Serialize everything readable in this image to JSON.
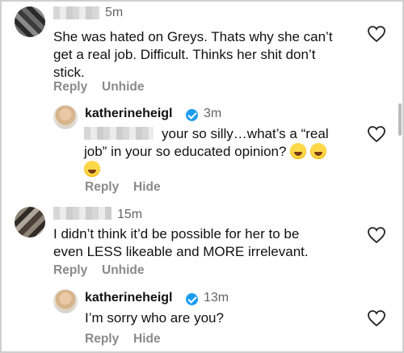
{
  "comments": [
    {
      "time": "5m",
      "text_lines": [
        "She was hated on Greys. Thats why she can’t",
        "get a real job. Difficult. Thinks her shit don’t",
        "stick."
      ],
      "reply_label": "Reply",
      "secondary_label": "Unhide"
    },
    {
      "username": "katherineheigl",
      "time": "3m",
      "text_lines": [
        "your so silly…what’s a “real",
        "job” in your so educated opinion?"
      ],
      "reply_label": "Reply",
      "secondary_label": "Hide",
      "emoji": "face-with-tears-of-joy"
    },
    {
      "time": "15m",
      "text_lines": [
        "I didn’t think it’d be possible for her to be",
        "even LESS likeable and MORE irrelevant."
      ],
      "reply_label": "Reply",
      "secondary_label": "Unhide"
    },
    {
      "username": "katherineheigl",
      "time": "13m",
      "text_lines": [
        "I’m sorry who are you?"
      ],
      "reply_label": "Reply",
      "secondary_label": "Hide"
    }
  ],
  "icons": {
    "like": "heart-outline-icon",
    "verified": "verified-badge-icon"
  },
  "colors": {
    "verified": "#1d9bf0",
    "muted": "#8a8a8a"
  }
}
